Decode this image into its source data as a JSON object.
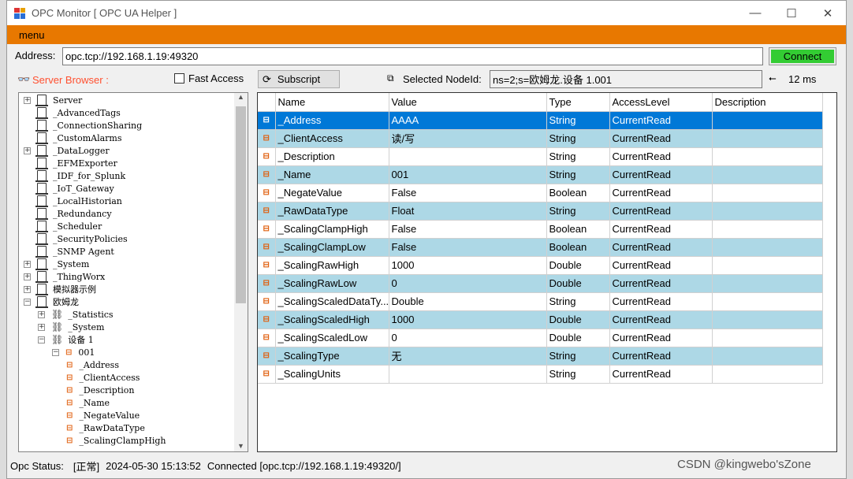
{
  "window": {
    "title": "OPC Monitor [ OPC UA Helper ]",
    "minimize": "—",
    "maximize": "☐",
    "close": "✕"
  },
  "menu": {
    "label": "menu"
  },
  "address": {
    "label": "Address:",
    "value": "opc.tcp://192.168.1.19:49320",
    "connect": "Connect"
  },
  "browser": {
    "label": "Server Browser :",
    "fast_access": "Fast Access",
    "subscript": "Subscript",
    "selected_label": "Selected NodeId:",
    "selected_value": "ns=2;s=欧姆龙.设备 1.001",
    "latency": "12 ms"
  },
  "tree": [
    {
      "text": "Server",
      "level": 0,
      "icon": "server",
      "exp": "+"
    },
    {
      "text": "_AdvancedTags",
      "level": 0,
      "icon": "server",
      "exp": ""
    },
    {
      "text": "_ConnectionSharing",
      "level": 0,
      "icon": "server",
      "exp": ""
    },
    {
      "text": "_CustomAlarms",
      "level": 0,
      "icon": "server",
      "exp": ""
    },
    {
      "text": "_DataLogger",
      "level": 0,
      "icon": "server",
      "exp": "+"
    },
    {
      "text": "_EFMExporter",
      "level": 0,
      "icon": "server",
      "exp": ""
    },
    {
      "text": "_IDF_for_Splunk",
      "level": 0,
      "icon": "server",
      "exp": ""
    },
    {
      "text": "_IoT_Gateway",
      "level": 0,
      "icon": "server",
      "exp": ""
    },
    {
      "text": "_LocalHistorian",
      "level": 0,
      "icon": "server",
      "exp": ""
    },
    {
      "text": "_Redundancy",
      "level": 0,
      "icon": "server",
      "exp": ""
    },
    {
      "text": "_Scheduler",
      "level": 0,
      "icon": "server",
      "exp": ""
    },
    {
      "text": "_SecurityPolicies",
      "level": 0,
      "icon": "server",
      "exp": ""
    },
    {
      "text": "_SNMP Agent",
      "level": 0,
      "icon": "server",
      "exp": ""
    },
    {
      "text": "_System",
      "level": 0,
      "icon": "server",
      "exp": "+"
    },
    {
      "text": "_ThingWorx",
      "level": 0,
      "icon": "server",
      "exp": "+"
    },
    {
      "text": "模拟器示例",
      "level": 0,
      "icon": "server",
      "exp": "+"
    },
    {
      "text": "欧姆龙",
      "level": 0,
      "icon": "server",
      "exp": "−"
    },
    {
      "text": "_Statistics",
      "level": 1,
      "icon": "group",
      "exp": "+"
    },
    {
      "text": "_System",
      "level": 1,
      "icon": "group",
      "exp": "+"
    },
    {
      "text": "设备 1",
      "level": 1,
      "icon": "group",
      "exp": "−"
    },
    {
      "text": "001",
      "level": 2,
      "icon": "tag",
      "exp": "−"
    },
    {
      "text": "_Address",
      "level": 3,
      "icon": "tag",
      "exp": ""
    },
    {
      "text": "_ClientAccess",
      "level": 3,
      "icon": "tag",
      "exp": ""
    },
    {
      "text": "_Description",
      "level": 3,
      "icon": "tag",
      "exp": ""
    },
    {
      "text": "_Name",
      "level": 3,
      "icon": "tag",
      "exp": ""
    },
    {
      "text": "_NegateValue",
      "level": 3,
      "icon": "tag",
      "exp": ""
    },
    {
      "text": "_RawDataType",
      "level": 3,
      "icon": "tag",
      "exp": ""
    },
    {
      "text": "_ScalingClampHigh",
      "level": 3,
      "icon": "tag",
      "exp": ""
    }
  ],
  "grid": {
    "columns": [
      "Name",
      "Value",
      "Type",
      "AccessLevel",
      "Description"
    ],
    "rows": [
      [
        "_Address",
        "AAAA",
        "String",
        "CurrentRead",
        ""
      ],
      [
        "_ClientAccess",
        "读/写",
        "String",
        "CurrentRead",
        ""
      ],
      [
        "_Description",
        "",
        "String",
        "CurrentRead",
        ""
      ],
      [
        "_Name",
        "001",
        "String",
        "CurrentRead",
        ""
      ],
      [
        "_NegateValue",
        "False",
        "Boolean",
        "CurrentRead",
        ""
      ],
      [
        "_RawDataType",
        "Float",
        "String",
        "CurrentRead",
        ""
      ],
      [
        "_ScalingClampHigh",
        "False",
        "Boolean",
        "CurrentRead",
        ""
      ],
      [
        "_ScalingClampLow",
        "False",
        "Boolean",
        "CurrentRead",
        ""
      ],
      [
        "_ScalingRawHigh",
        "1000",
        "Double",
        "CurrentRead",
        ""
      ],
      [
        "_ScalingRawLow",
        "0",
        "Double",
        "CurrentRead",
        ""
      ],
      [
        "_ScalingScaledDataTy...",
        "Double",
        "String",
        "CurrentRead",
        ""
      ],
      [
        "_ScalingScaledHigh",
        "1000",
        "Double",
        "CurrentRead",
        ""
      ],
      [
        "_ScalingScaledLow",
        "0",
        "Double",
        "CurrentRead",
        ""
      ],
      [
        "_ScalingType",
        "无",
        "String",
        "CurrentRead",
        ""
      ],
      [
        "_ScalingUnits",
        "",
        "String",
        "CurrentRead",
        ""
      ]
    ]
  },
  "status": {
    "label": "Opc Status:",
    "state": "[正常]",
    "time": "2024-05-30 15:13:52",
    "message": "Connected [opc.tcp://192.168.1.19:49320/]"
  },
  "watermark": "CSDN @kingwebo'sZone",
  "colors": {
    "menu": "#e87800",
    "connect": "#33cc33",
    "selected_row": "#0078d7",
    "alt_row": "#add8e6",
    "browser_label": "#ff5030"
  }
}
